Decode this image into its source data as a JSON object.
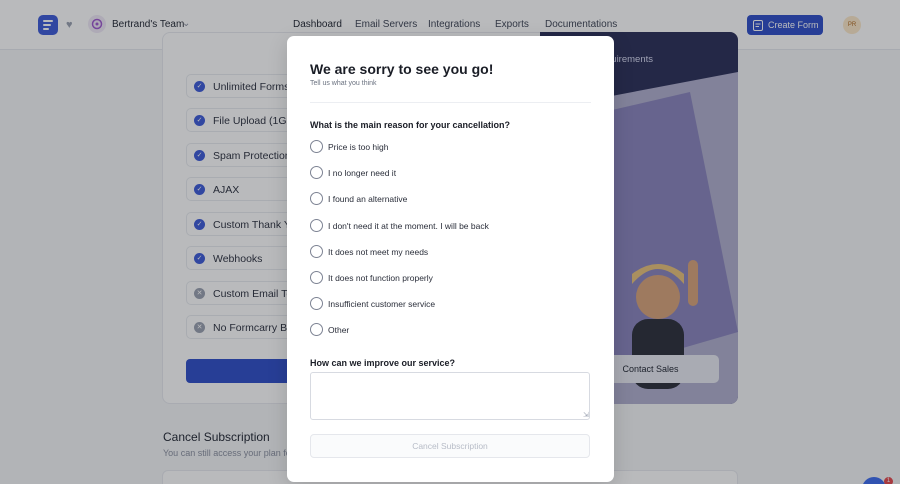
{
  "header": {
    "team_name": "Bertrand's Team",
    "nav": [
      "Dashboard",
      "Email Servers",
      "Integrations",
      "Exports",
      "Documentations"
    ],
    "create_button": "Create Form",
    "avatar_initials": "PR"
  },
  "plan": {
    "features": [
      {
        "label": "Unlimited Forms",
        "included": true
      },
      {
        "label": "File Upload (1GB)",
        "included": true
      },
      {
        "label": "Spam Protection",
        "included": true
      },
      {
        "label": "AJAX",
        "included": true
      },
      {
        "label": "Custom Thank Yo",
        "included": true
      },
      {
        "label": "Webhooks",
        "included": true
      },
      {
        "label": "Custom Email Ter",
        "included": false
      },
      {
        "label": "No Formcarry Bra",
        "included": false
      }
    ],
    "promo_text": "quirements",
    "contact_button": "Contact Sales"
  },
  "cancel_section": {
    "title": "Cancel Subscription",
    "description": "You can still access your plan fea"
  },
  "help_badge_count": "1",
  "modal": {
    "title": "We are sorry to see you go!",
    "subtitle": "Tell us what you think",
    "reason_question": "What is the main reason for your cancellation?",
    "options": [
      "Price is too high",
      "I no longer need it",
      "I found an alternative",
      "I don't need it at the moment. I will be back",
      "It does not meet my needs",
      "It does not function properly",
      "Insufficient customer service",
      "Other"
    ],
    "improve_question": "How can we improve our service?",
    "feedback_value": "",
    "cancel_button": "Cancel Subscription"
  },
  "colors": {
    "brand": "#2f4ec9",
    "promo_background": "#2a2e58",
    "excluded_feature": "#9aa1b0"
  }
}
